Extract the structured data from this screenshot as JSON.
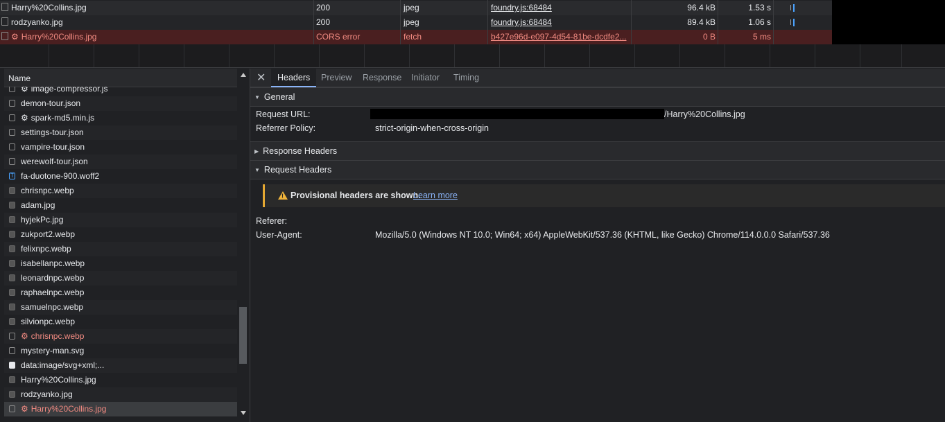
{
  "requests": [
    {
      "name": "Harry%20Collins.jpg",
      "status": "200",
      "type": "jpeg",
      "initiator": "foundry.js:68484",
      "size": "96.4 kB",
      "time": "1.53 s",
      "error": false
    },
    {
      "name": "rodzyanko.jpg",
      "status": "200",
      "type": "jpeg",
      "initiator": "foundry.js:68484",
      "size": "89.4 kB",
      "time": "1.06 s",
      "error": false
    },
    {
      "name": "Harry%20Collins.jpg",
      "status": "CORS error",
      "type": "fetch",
      "initiator": "b427e96d-e097-4d54-81be-dcdfe2...",
      "size": "0 B",
      "time": "5 ms",
      "error": true
    }
  ],
  "name_column": {
    "header": "Name"
  },
  "name_list": [
    {
      "name": "image-compressor.js",
      "icon": "gear-icon",
      "error": false
    },
    {
      "name": "demon-tour.json",
      "icon": "file-icon",
      "error": false
    },
    {
      "name": "spark-md5.min.js",
      "icon": "gear-icon",
      "error": false
    },
    {
      "name": "settings-tour.json",
      "icon": "file-icon",
      "error": false
    },
    {
      "name": "vampire-tour.json",
      "icon": "file-icon",
      "error": false
    },
    {
      "name": "werewolf-tour.json",
      "icon": "file-icon",
      "error": false
    },
    {
      "name": "fa-duotone-900.woff2",
      "icon": "font-icon",
      "error": false
    },
    {
      "name": "chrisnpc.webp",
      "icon": "image-icon",
      "error": false
    },
    {
      "name": "adam.jpg",
      "icon": "image-icon",
      "error": false
    },
    {
      "name": "hyjekPc.jpg",
      "icon": "image-icon",
      "error": false
    },
    {
      "name": "zukport2.webp",
      "icon": "image-icon",
      "error": false
    },
    {
      "name": "felixnpc.webp",
      "icon": "image-icon",
      "error": false
    },
    {
      "name": "isabellanpc.webp",
      "icon": "image-icon",
      "error": false
    },
    {
      "name": "leonardnpc.webp",
      "icon": "image-icon",
      "error": false
    },
    {
      "name": "raphaelnpc.webp",
      "icon": "image-icon",
      "error": false
    },
    {
      "name": "samuelnpc.webp",
      "icon": "image-icon",
      "error": false
    },
    {
      "name": "silvionpc.webp",
      "icon": "image-icon",
      "error": false
    },
    {
      "name": "chrisnpc.webp",
      "icon": "error-icon",
      "error": true
    },
    {
      "name": "mystery-man.svg",
      "icon": "file-icon",
      "error": false
    },
    {
      "name": "data:image/svg+xml;...",
      "icon": "svg-data-icon",
      "error": false
    },
    {
      "name": "Harry%20Collins.jpg",
      "icon": "image-icon",
      "error": false
    },
    {
      "name": "rodzyanko.jpg",
      "icon": "image-icon",
      "error": false
    },
    {
      "name": "Harry%20Collins.jpg",
      "icon": "error-icon",
      "error": true
    }
  ],
  "tabs": [
    "Headers",
    "Preview",
    "Response",
    "Initiator",
    "Timing"
  ],
  "active_tab": "Headers",
  "general": {
    "title": "General",
    "request_url_label": "Request URL:",
    "request_url_value": "/Harry%20Collins.jpg",
    "referrer_policy_label": "Referrer Policy:",
    "referrer_policy_value": "strict-origin-when-cross-origin"
  },
  "response_headers": {
    "title": "Response Headers"
  },
  "request_headers": {
    "title": "Request Headers",
    "provisional_text": "Provisional headers are shown.",
    "learn_more": "Learn more",
    "referer_label": "Referer:",
    "user_agent_label": "User-Agent:",
    "user_agent_value": "Mozilla/5.0 (Windows NT 10.0; Win64; x64) AppleWebKit/537.36 (KHTML, like Gecko) Chrome/114.0.0.0 Safari/537.36"
  },
  "colors": {
    "error": "#f28b82",
    "accent": "#8ab4f8",
    "warning": "#f0b43a"
  }
}
